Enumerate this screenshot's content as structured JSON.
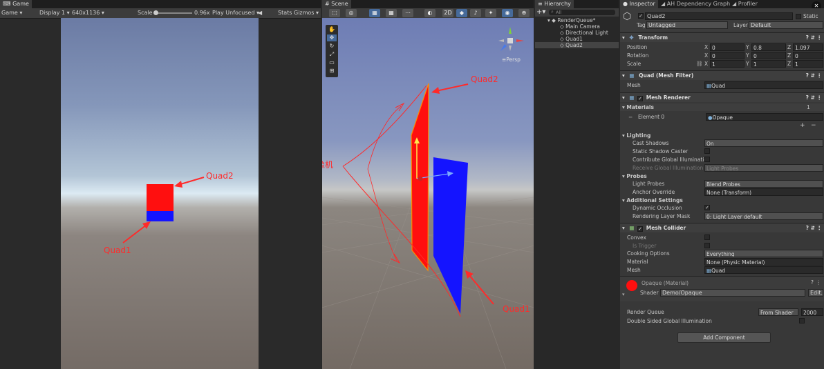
{
  "game": {
    "tab": "Game",
    "display_mode": "Game",
    "display": "Display 1",
    "resolution": "640x1136",
    "scale_label": "Scale",
    "scale_value": "0.96x",
    "play_mode": "Play Unfocused",
    "stats": "Stats",
    "gizmos": "Gizmos",
    "annotations": {
      "quad2": "Quad2",
      "quad1": "Quad1"
    }
  },
  "scene": {
    "tab": "Scene",
    "mode_2d": "2D",
    "persp": "Persp",
    "annotations": {
      "quad2": "Quad2",
      "camera": "摄像机",
      "quad1": "Quad1"
    }
  },
  "hierarchy": {
    "tab": "Hierarchy",
    "search_placeholder": "All",
    "scene_name": "RenderQueue*",
    "items": [
      "Main Camera",
      "Directional Light",
      "Quad1",
      "Quad2"
    ]
  },
  "inspector": {
    "tabs": [
      "Inspector",
      "AH Dependency Graph",
      "Profiler"
    ],
    "object_name": "Quad2",
    "static_label": "Static",
    "tag_label": "Tag",
    "tag_value": "Untagged",
    "layer_label": "Layer",
    "layer_value": "Default",
    "transform": {
      "title": "Transform",
      "position_label": "Position",
      "rotation_label": "Rotation",
      "scale_label": "Scale",
      "position": [
        "0",
        "0.8",
        "1.097"
      ],
      "rotation": [
        "0",
        "0",
        "0"
      ],
      "scale": [
        "1",
        "1",
        "1"
      ],
      "axes": [
        "X",
        "Y",
        "Z"
      ]
    },
    "mesh_filter": {
      "title": "Quad (Mesh Filter)",
      "mesh_label": "Mesh",
      "mesh_value": "Quad"
    },
    "mesh_renderer": {
      "title": "Mesh Renderer",
      "materials_label": "Materials",
      "materials_count": "1",
      "element_label": "Element 0",
      "element_value": "Opaque",
      "lighting_label": "Lighting",
      "cast_shadows_label": "Cast Shadows",
      "cast_shadows_value": "On",
      "static_shadow_label": "Static Shadow Caster",
      "contribute_gi_label": "Contribute Global Illumination",
      "receive_gi_label": "Receive Global Illumination",
      "receive_gi_value": "Light Probes",
      "probes_label": "Probes",
      "light_probes_label": "Light Probes",
      "light_probes_value": "Blend Probes",
      "anchor_label": "Anchor Override",
      "anchor_value": "None (Transform)",
      "additional_label": "Additional Settings",
      "dynamic_occlusion_label": "Dynamic Occlusion",
      "rendering_layer_label": "Rendering Layer Mask",
      "rendering_layer_value": "0: Light Layer default"
    },
    "mesh_collider": {
      "title": "Mesh Collider",
      "convex_label": "Convex",
      "trigger_label": "Is Trigger",
      "cooking_label": "Cooking Options",
      "cooking_value": "Everything",
      "material_label": "Material",
      "material_value": "None (Physic Material)",
      "mesh_label": "Mesh",
      "mesh_value": "Quad"
    },
    "material": {
      "title": "Opaque (Material)",
      "shader_label": "Shader",
      "shader_value": "Demo/Opaque",
      "edit_label": "Edit...",
      "render_queue_label": "Render Queue",
      "render_queue_mode": "From Shader",
      "render_queue_value": "2000",
      "double_sided_label": "Double Sided Global Illumination"
    },
    "add_component": "Add Component"
  },
  "colors": {
    "quad_red": "#ff0f0f",
    "quad_blue": "#1414ff",
    "annotation": "#ff2a2a",
    "selection": "#2c5d87"
  },
  "icons": [
    "gamepad-icon",
    "hand-icon",
    "move-icon",
    "rotate-icon",
    "scale-icon",
    "rect-icon",
    "transform-icon",
    "light-icon",
    "audio-icon",
    "gizmo-axis-icon",
    "cube-icon",
    "settings-icon",
    "lock-icon",
    "link-icon"
  ]
}
